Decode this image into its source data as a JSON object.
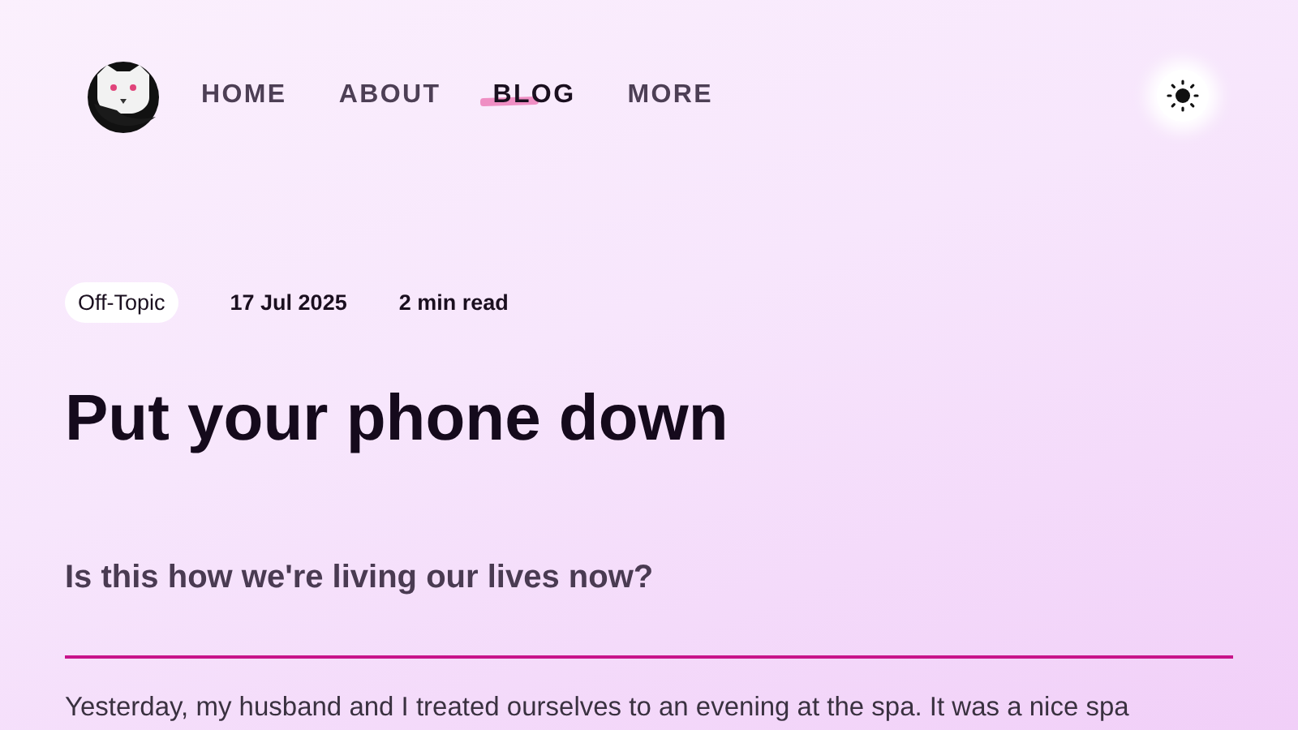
{
  "nav": {
    "items": [
      {
        "label": "HOME",
        "selected": false
      },
      {
        "label": "ABOUT",
        "selected": false
      },
      {
        "label": "BLOG",
        "selected": true
      },
      {
        "label": "MORE",
        "selected": false
      }
    ]
  },
  "post": {
    "tag": "Off-Topic",
    "date": "17 Jul 2025",
    "read_time": "2 min read",
    "title": "Put your phone down",
    "subtitle": "Is this how we're living our lives now?",
    "body": "Yesterday, my husband and I treated ourselves to an evening at the spa. It was a nice spa"
  }
}
